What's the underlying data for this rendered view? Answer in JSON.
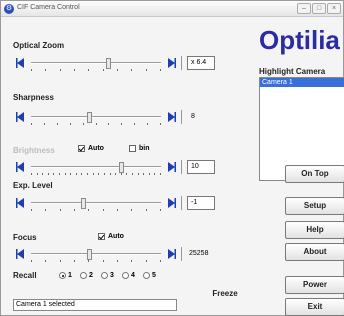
{
  "window": {
    "title": "CIF Camera Control"
  },
  "logo": {
    "text": "Optilia"
  },
  "camera_list": {
    "heading": "Highlight Camera",
    "items": [
      "Camera 1"
    ],
    "selected": "Camera 1"
  },
  "controls": {
    "zoom": {
      "label": "Optical Zoom",
      "value": "x 6.4",
      "level": 0.6
    },
    "sharpness": {
      "label": "Sharpness",
      "value": "8",
      "level": 0.45
    },
    "brightness": {
      "label": "Brightness",
      "auto_label": "Auto",
      "auto_checked": true,
      "bin_label": "bin",
      "bin_checked": false,
      "value": "10",
      "level": 0.7
    },
    "exp": {
      "label": "Exp. Level",
      "value": "-1",
      "level": 0.4
    },
    "focus": {
      "label": "Focus",
      "auto_label": "Auto",
      "auto_checked": true,
      "value": "25258",
      "level": 0.45
    }
  },
  "recall": {
    "label": "Recall",
    "options": [
      "1",
      "2",
      "3",
      "4",
      "5"
    ],
    "selected": 0
  },
  "buttons": {
    "on_top": "On Top",
    "setup": "Setup",
    "help": "Help",
    "about": "About",
    "power": "Power",
    "exit": "Exit",
    "freeze": "Freeze"
  },
  "status": {
    "text": "Camera 1 selected"
  },
  "colors": {
    "logo": "#2b2ba8",
    "arrow": "#1b3fb5",
    "selection": "#3a6fd8"
  }
}
